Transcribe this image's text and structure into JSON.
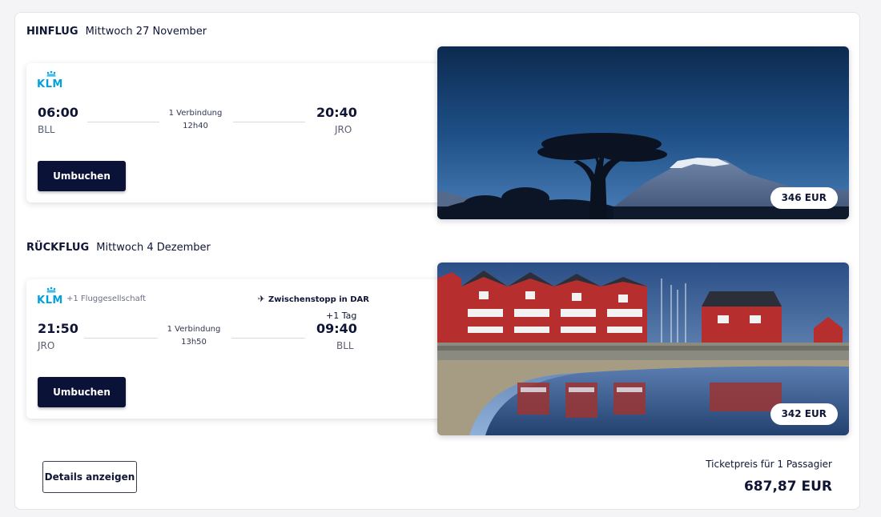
{
  "outbound": {
    "kind_label": "HINFLUG",
    "date_label": "Mittwoch 27 November",
    "airline_logo_text": "KLM",
    "departure_time": "06:00",
    "departure_airport": "BLL",
    "connections": "1 Verbindung",
    "duration": "12h40",
    "arrival_time": "20:40",
    "arrival_airport": "JRO",
    "rebook_label": "Umbuchen",
    "price_label": "346 EUR",
    "image_icon": "kilimanjaro-landscape"
  },
  "return": {
    "kind_label": "RÜCKFLUG",
    "date_label": "Mittwoch 4 Dezember",
    "airline_logo_text": "KLM",
    "extra_airlines": "+1 Fluggesellschaft",
    "stopover_label": "Zwischenstopp in DAR",
    "departure_time": "21:50",
    "departure_airport": "JRO",
    "connections": "1 Verbindung",
    "duration": "13h50",
    "day_offset": "+1 Tag",
    "arrival_time": "09:40",
    "arrival_airport": "BLL",
    "rebook_label": "Umbuchen",
    "price_label": "342 EUR",
    "image_icon": "harbor-houses-landscape"
  },
  "footer": {
    "details_label": "Details anzeigen",
    "ticket_price_label": "Ticketpreis für 1 Passagier",
    "ticket_price_total": "687,87 EUR"
  },
  "colors": {
    "primary_dark": "#0a1238",
    "klm_blue": "#00a1de",
    "text": "#0f1535"
  }
}
